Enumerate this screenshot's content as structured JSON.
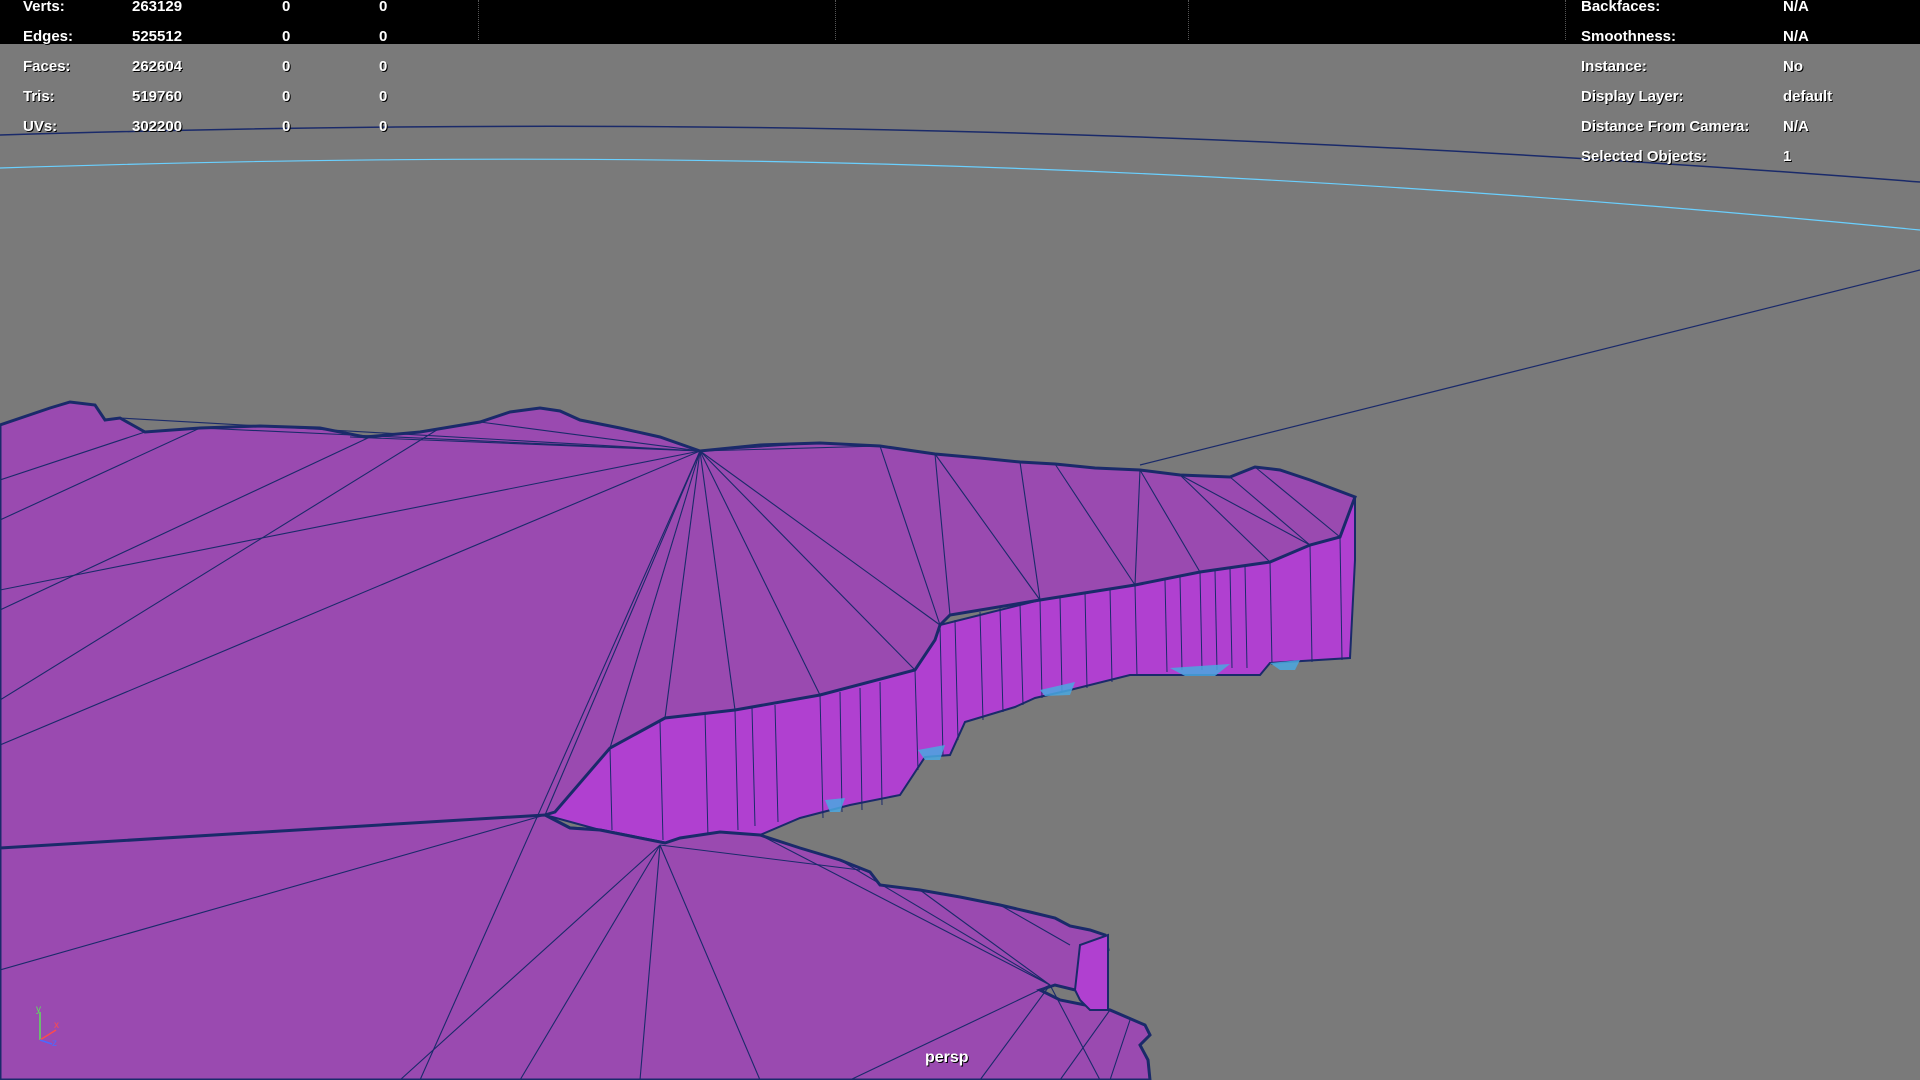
{
  "viewport": {
    "camera_name": "persp"
  },
  "poly_count": {
    "rows": [
      {
        "label": "Verts:",
        "total": "263129",
        "selected": "0",
        "selected_obj": "0"
      },
      {
        "label": "Edges:",
        "total": "525512",
        "selected": "0",
        "selected_obj": "0"
      },
      {
        "label": "Faces:",
        "total": "262604",
        "selected": "0",
        "selected_obj": "0"
      },
      {
        "label": "Tris:",
        "total": "519760",
        "selected": "0",
        "selected_obj": "0"
      },
      {
        "label": "UVs:",
        "total": "302200",
        "selected": "0",
        "selected_obj": "0"
      }
    ]
  },
  "object_details": {
    "rows": [
      {
        "label": "Backfaces:",
        "value": "N/A"
      },
      {
        "label": "Smoothness:",
        "value": "N/A"
      },
      {
        "label": "Instance:",
        "value": "No"
      },
      {
        "label": "Display Layer:",
        "value": "default"
      },
      {
        "label": "Distance From Camera:",
        "value": "N/A"
      },
      {
        "label": "Selected Objects:",
        "value": "1"
      }
    ]
  },
  "axis": {
    "x_label": "x",
    "y_label": "y",
    "z_label": "z"
  },
  "colors": {
    "viewport_bg": "#7a7a7a",
    "mesh_top": "#9a4ab0",
    "mesh_wall": "#b040d0",
    "wireframe": "#1a2a6a",
    "highlight_edge": "#4aa8e0",
    "horizon_line": "#6ad0ff"
  }
}
